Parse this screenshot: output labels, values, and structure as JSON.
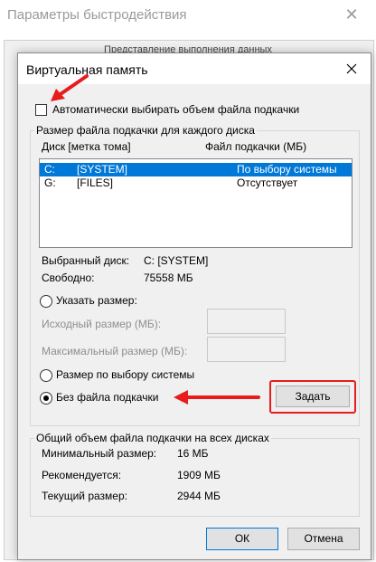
{
  "background_window": {
    "title": "Параметры быстродействия",
    "tab_label": "Представление выполнения данных"
  },
  "dialog": {
    "title": "Виртуальная память",
    "auto_manage_label": "Автоматически выбирать объем файла подкачки",
    "auto_manage_checked": false,
    "group1_legend": "Размер файла подкачки для каждого диска",
    "list": {
      "col_drive": "Диск [метка тома]",
      "col_paging": "Файл подкачки (МБ)",
      "rows": [
        {
          "drive": "C:",
          "label": "[SYSTEM]",
          "paging": "По выбору системы",
          "selected": true
        },
        {
          "drive": "G:",
          "label": "[FILES]",
          "paging": "Отсутствует",
          "selected": false
        }
      ]
    },
    "selected_drive_label": "Выбранный диск:",
    "selected_drive_value": "C:  [SYSTEM]",
    "free_label": "Свободно:",
    "free_value": "75558 МБ",
    "custom_size_label": "Указать размер:",
    "initial_size_label": "Исходный размер (МБ):",
    "max_size_label": "Максимальный размер (МБ):",
    "system_managed_label": "Размер по выбору системы",
    "no_paging_label": "Без файла подкачки",
    "selected_option": "no_paging",
    "set_button": "Задать",
    "group2_legend": "Общий объем файла подкачки на всех дисках",
    "totals": {
      "min_label": "Минимальный размер:",
      "min_value": "16 МБ",
      "recommended_label": "Рекомендуется:",
      "recommended_value": "1909 МБ",
      "current_label": "Текущий размер:",
      "current_value": "2944 МБ"
    },
    "ok_button": "ОК",
    "cancel_button": "Отмена"
  },
  "colors": {
    "selection": "#0078d7",
    "annotation_red": "#e81c1c"
  },
  "icons": {
    "close": "close-icon",
    "arrow": "red-arrow-icon"
  }
}
